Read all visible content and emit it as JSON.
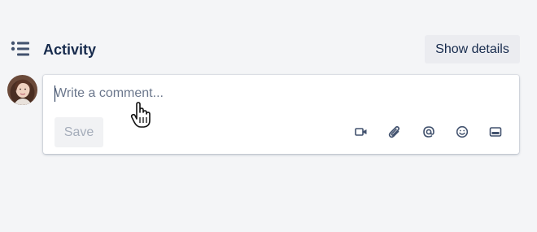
{
  "activity": {
    "title": "Activity",
    "icon": "activity-list-icon",
    "show_details_label": "Show details"
  },
  "comment": {
    "placeholder": "Write a comment...",
    "value": "",
    "save_label": "Save",
    "tools": [
      {
        "name": "video-icon"
      },
      {
        "name": "attachment-icon"
      },
      {
        "name": "mention-icon"
      },
      {
        "name": "emoji-icon"
      },
      {
        "name": "card-icon"
      }
    ]
  },
  "user": {
    "avatar": "user-avatar"
  },
  "colors": {
    "background": "#f4f5f7",
    "text": "#172b4d",
    "button_bg": "#ebecf0",
    "disabled_text": "#a5adba",
    "icon": "#42526e"
  }
}
